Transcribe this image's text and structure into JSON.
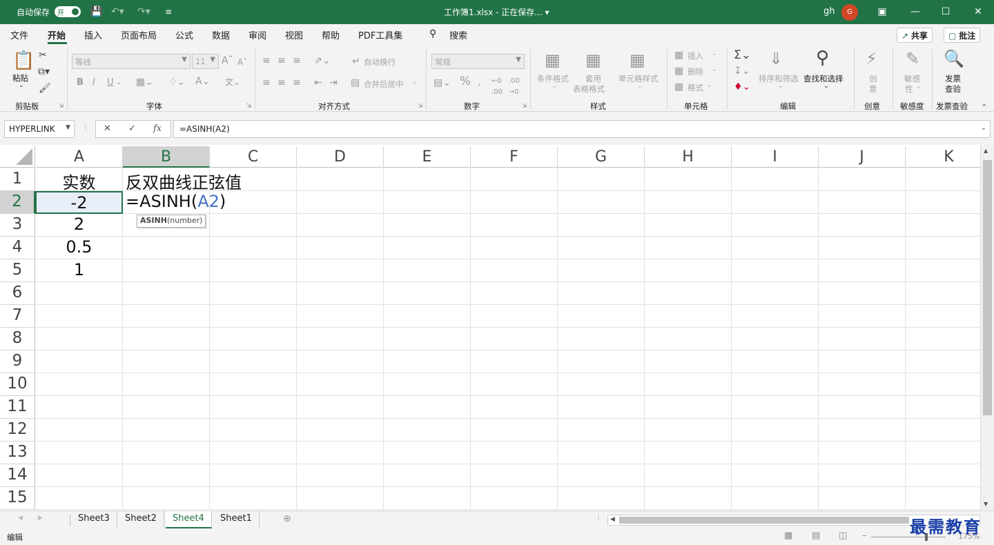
{
  "titlebar": {
    "autosave_label": "自动保存",
    "autosave_state": "开",
    "document_title": "工作簿1.xlsx - 正在保存... ▾",
    "user_name": "gh",
    "user_initial": "G",
    "bg_color": "#217346"
  },
  "menu": {
    "tabs": [
      "文件",
      "开始",
      "插入",
      "页面布局",
      "公式",
      "数据",
      "审阅",
      "视图",
      "帮助",
      "PDF工具集"
    ],
    "search_label": "搜索",
    "share_label": "共享",
    "comments_label": "批注"
  },
  "ribbon": {
    "clipboard": {
      "paste": "粘贴",
      "group": "剪贴板"
    },
    "font": {
      "name": "等线",
      "size": "11",
      "group": "字体",
      "bold": "B",
      "italic": "I",
      "underline": "U"
    },
    "alignment": {
      "wrap": "自动换行",
      "merge": "合并后居中",
      "group": "对齐方式"
    },
    "number": {
      "format": "常规",
      "group": "数字",
      "percent": "%"
    },
    "styles": {
      "cond": "条件格式",
      "table1": "套用",
      "table2": "表格格式",
      "cell": "单元格样式",
      "group": "样式"
    },
    "cells": {
      "insert": "插入",
      "delete": "删除",
      "format": "格式",
      "group": "单元格"
    },
    "editing": {
      "sort": "排序和筛选",
      "find": "查找和选择",
      "group": "编辑"
    },
    "ideas": {
      "label1": "创",
      "label2": "意",
      "group": "创意"
    },
    "sensitivity": {
      "label1": "敏感",
      "label2": "性",
      "group": "敏感度"
    },
    "invoice": {
      "label1": "发票",
      "label2": "查验",
      "group": "发票查验"
    }
  },
  "formula_bar": {
    "name_box": "HYPERLINK",
    "formula": "=ASINH(A2)"
  },
  "sheet": {
    "columns": [
      "A",
      "B",
      "C",
      "D",
      "E",
      "F",
      "G",
      "H",
      "I",
      "J",
      "K"
    ],
    "rows": [
      "1",
      "2",
      "3",
      "4",
      "5",
      "6",
      "7",
      "8",
      "9",
      "10",
      "11",
      "12",
      "13",
      "14",
      "15"
    ],
    "selected_column": "B",
    "selected_row": "2",
    "cells": {
      "A1": "实数",
      "B1": "反双曲线正弦值",
      "A2": "-2",
      "B2_prefix": "=ASINH(",
      "B2_ref": "A2",
      "B2_suffix": ")",
      "A3": "2",
      "A4": "0.5",
      "A5": "1"
    },
    "tooltip_fn": "ASINH",
    "tooltip_arg": "(number)",
    "ref_color": "#4472c4"
  },
  "sheet_tabs": [
    "Sheet3",
    "Sheet2",
    "Sheet4",
    "Sheet1"
  ],
  "active_sheet": "Sheet4",
  "status": {
    "mode": "编辑",
    "zoom": "175%"
  },
  "watermark": "最需教育"
}
